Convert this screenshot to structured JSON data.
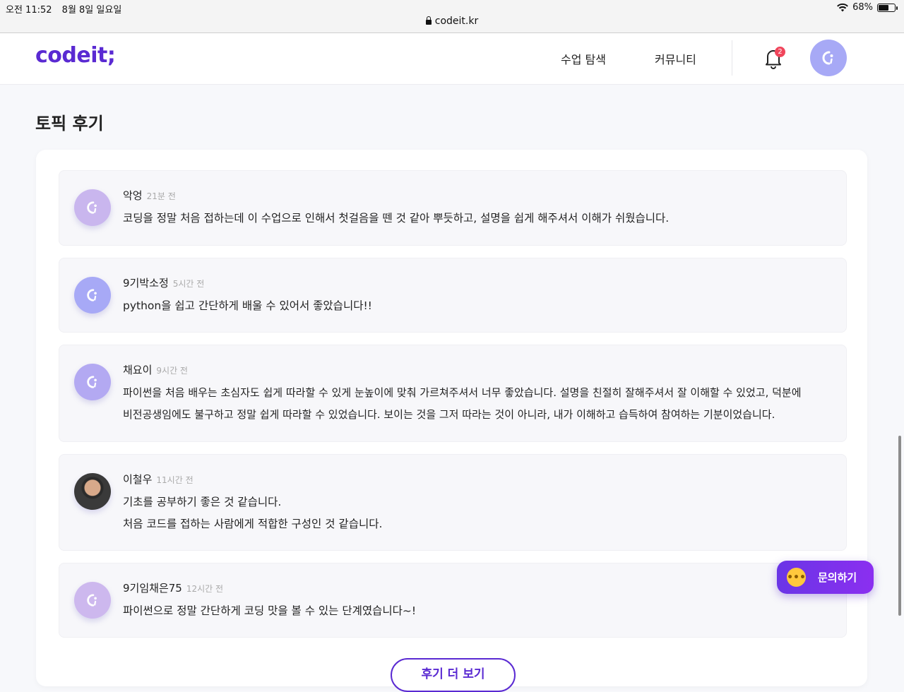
{
  "status_bar": {
    "time": "오전 11:52",
    "date": "8월 8일 일요일",
    "battery": "68%",
    "battery_level": 0.68
  },
  "browser": {
    "url": "codeit.kr"
  },
  "header": {
    "logo": "codeit;",
    "nav": [
      {
        "label": "수업 탐색"
      },
      {
        "label": "커뮤니티"
      }
    ],
    "notification_count": "2"
  },
  "page": {
    "title": "토픽 후기"
  },
  "reviews": [
    {
      "name": "악엉",
      "time": "21분 전",
      "lines": [
        "코딩을 정말 처음 접하는데 이 수업으로 인해서 첫걸음을 뗀 것 같아 뿌듯하고, 설명을 쉽게 해주셔서 이해가 쉬웠습니다."
      ],
      "avatar_color": "#c9b6ee"
    },
    {
      "name": "9기박소정",
      "time": "5시간 전",
      "lines": [
        "python을 쉽고 간단하게 배울 수 있어서 좋았습니다!!"
      ],
      "avatar_color": "#a7a9f6"
    },
    {
      "name": "채요이",
      "time": "9시간 전",
      "lines": [
        "파이썬을 처음 배우는 초심자도 쉽게 따라할 수 있게 눈높이에 맞춰 가르쳐주셔서 너무 좋았습니다. 설명을 친절히 잘해주셔서 잘 이해할 수 있었고, 덕분에",
        "비전공생임에도 불구하고 정말 쉽게 따라할 수 있었습니다. 보이는 것을 그저 따라는 것이 아니라, 내가 이해하고 습득하여 참여하는 기분이었습니다."
      ],
      "avatar_color": "#b3a9f2"
    },
    {
      "name": "이철우",
      "time": "11시간 전",
      "lines": [
        "기초를 공부하기 좋은 것 같습니다.",
        "처음 코드를 접하는 사람에게 적합한 구성인 것 같습니다."
      ],
      "avatar_color": "#333333"
    },
    {
      "name": "9기임채은75",
      "time": "12시간 전",
      "lines": [
        "파이썬으로 정말 간단하게 코딩 맛을 볼 수 있는 단계였습니다~!"
      ],
      "avatar_color": "#cdb8ee"
    }
  ],
  "inquiry_button": "문의하기",
  "more_button": "후기 더 보기",
  "colors": {
    "brand": "#5a2ad2",
    "badge": "#f0455b"
  }
}
